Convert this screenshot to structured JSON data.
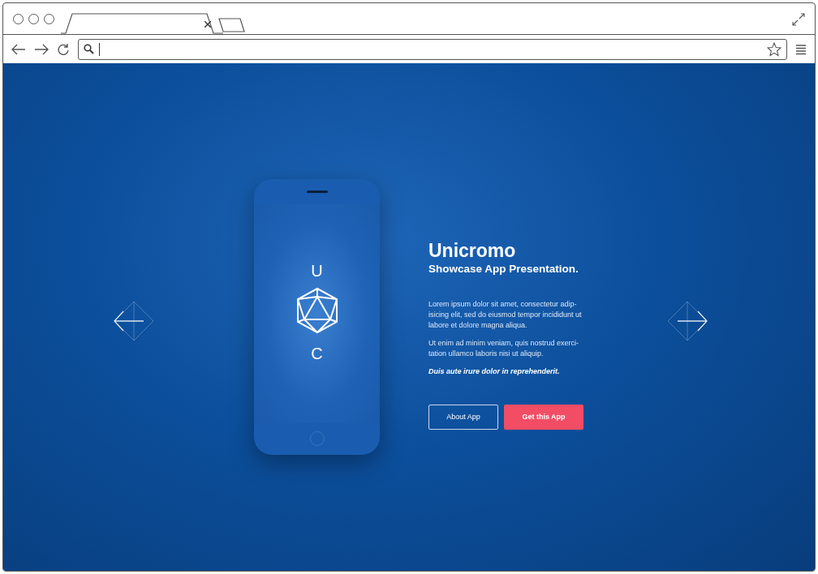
{
  "browser": {
    "tabs": [
      {
        "selected": true
      },
      {
        "selected": false
      }
    ]
  },
  "phone": {
    "logo_top": "U",
    "logo_bottom": "C"
  },
  "hero": {
    "title": "Unicromo",
    "subtitle": "Showcase App Presentation.",
    "paragraphs": [
      "Lorem ipsum dolor sit amet, consectetur adip-isicing elit, sed do eiusmod tempor incididunt ut labore et dolore magna aliqua.",
      "Ut enim ad minim veniam, quis nostrud exerci-tation ullamco laboris nisi ut aliquip."
    ],
    "emphasis": "Duis aute irure dolor in reprehenderit.",
    "buttons": [
      {
        "label": "About App",
        "kind": "outline"
      },
      {
        "label": "Get this App",
        "kind": "filled"
      }
    ]
  }
}
